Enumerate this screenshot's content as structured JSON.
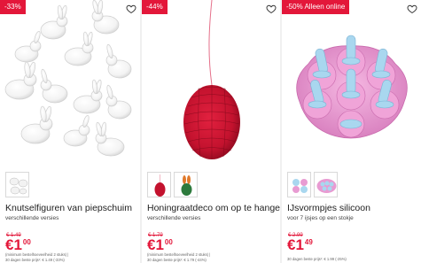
{
  "products": [
    {
      "badge": "-33%",
      "title": "Knutselfiguren van piepschuim",
      "subtitle": "verschillende versies",
      "old_price": "€ 1.49",
      "price_main": "€1",
      "price_decimals": "00",
      "fine_print_1": "(minimum bestelhoeveelheid 2 stuks) |",
      "fine_print_2": "30 dagen beste prijs¹: € 1.49 (-33%)"
    },
    {
      "badge": "-44%",
      "title": "Honingraatdeco om op te hangen",
      "subtitle": "verschillende versies",
      "old_price": "€ 1.79",
      "price_main": "€1",
      "price_decimals": "00",
      "fine_print_1": "(minimum bestelhoeveelheid 2 stuks) |",
      "fine_print_2": "30 dagen beste prijs¹: € 1.79 (-44%)"
    },
    {
      "badge": "-50% Alleen online",
      "title": "IJsvormpjes silicoon",
      "subtitle": "voor 7 ijsjes op een stokje",
      "old_price": "€ 2.99",
      "price_main": "€1",
      "price_decimals": "49",
      "fine_print_1": "30 dagen beste prijs¹: € 1.99 (-25%)"
    }
  ],
  "colors": {
    "accent": "#e3173a",
    "honeycomb": "#c3122e",
    "mold_pink": "#e89bd2",
    "mold_blue": "#a9d7ef"
  },
  "icons": {
    "favorite": "heart-icon"
  }
}
